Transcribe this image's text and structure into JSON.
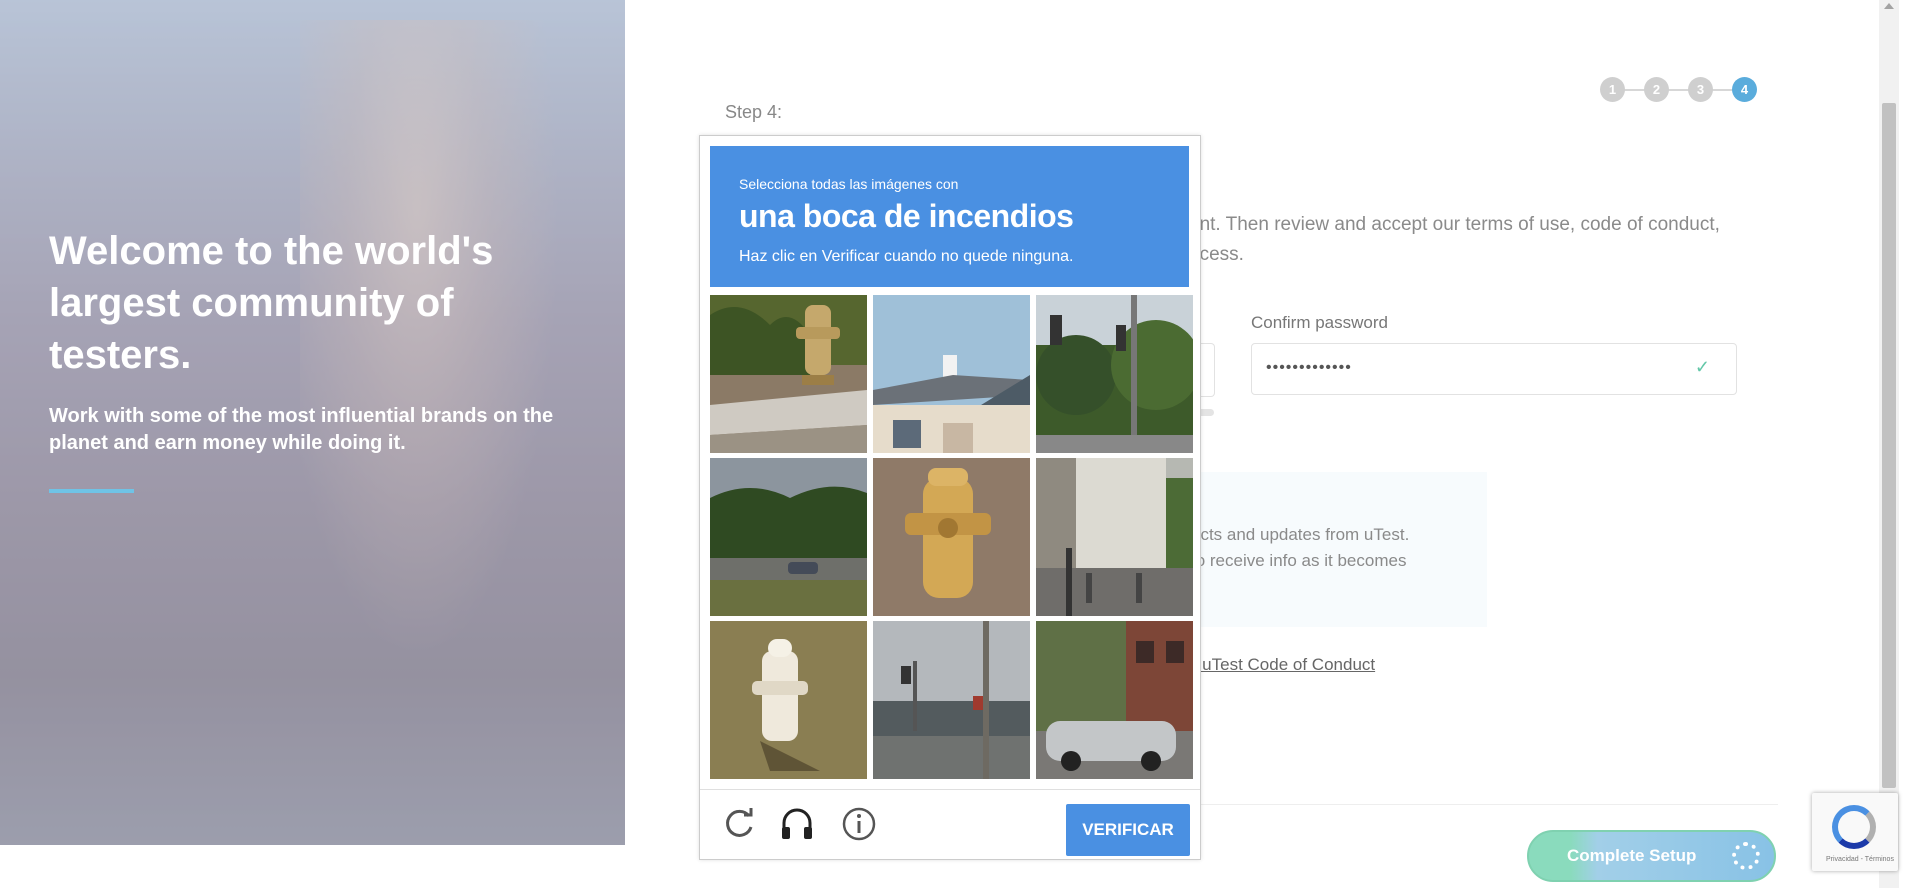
{
  "hero": {
    "title": "Welcome to the world's largest community of testers.",
    "subtitle": "Work with some of the most influential brands on the planet and earn money while doing it."
  },
  "signup": {
    "step_label": "Step 4:",
    "steps": [
      "1",
      "2",
      "3",
      "4"
    ],
    "active_step": 4,
    "description": "unt. Then review and accept our terms of use, code of conduct, ocess.",
    "confirm_password_label": "Confirm password",
    "confirm_password_value": "•••••••••••••",
    "optin_text_line1": "ects and updates from uTest.",
    "optin_text_line2": "to receive info as it becomes",
    "coc_link": "e uTest Code of Conduct",
    "complete_button": "Complete Setup"
  },
  "captcha": {
    "instruction_line1": "Selecciona todas las imágenes con",
    "target": "una boca de incendios",
    "instruction_line3": "Haz clic en Verificar cuando no quede ninguna.",
    "verify_button": "VERIFICAR",
    "tiles": [
      "hydrant-closeup",
      "house-roof",
      "traffic-lights",
      "highway-trees",
      "hydrant-gravel",
      "city-street",
      "hydrant-grass",
      "street-poles",
      "parked-car-street"
    ],
    "footer_icons": [
      "reload-icon",
      "audio-icon",
      "info-icon"
    ]
  },
  "recaptcha_badge": {
    "terms": "Privacidad - Términos"
  }
}
